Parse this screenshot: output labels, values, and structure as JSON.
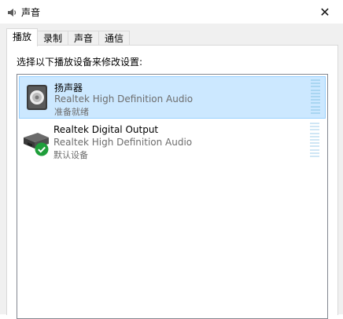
{
  "window": {
    "title": "声音",
    "close_glyph": "✕"
  },
  "tabs": [
    {
      "label": "播放",
      "active": true
    },
    {
      "label": "录制",
      "active": false
    },
    {
      "label": "声音",
      "active": false
    },
    {
      "label": "通信",
      "active": false
    }
  ],
  "playback": {
    "instruction": "选择以下播放设备来修改设置:",
    "devices": [
      {
        "name": "扬声器",
        "driver": "Realtek High Definition Audio",
        "status": "准备就绪",
        "icon": "speaker-icon",
        "selected": true
      },
      {
        "name": "Realtek Digital Output",
        "driver": "Realtek High Definition Audio",
        "status": "默认设备",
        "icon": "digital-output-icon",
        "default_badge_icon": "green-checkmark-icon",
        "selected": false
      }
    ]
  },
  "colors": {
    "selection_bg": "#cce8ff",
    "selection_border": "#99d1ff",
    "check_green": "#1e9e3a"
  }
}
